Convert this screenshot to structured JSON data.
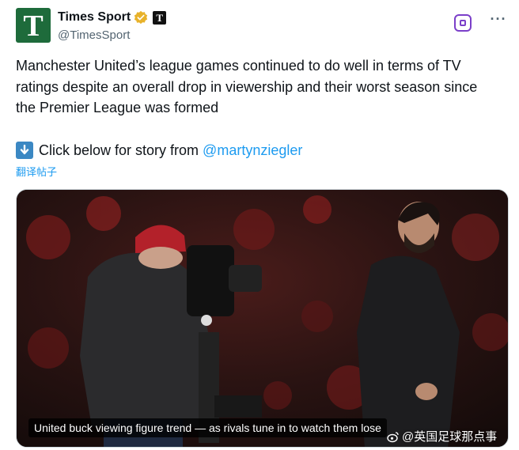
{
  "header": {
    "avatar_letter": "T",
    "display_name": "Times Sport",
    "affiliate_letter": "T",
    "handle": "@TimesSport"
  },
  "tweet": {
    "text": "Manchester United’s league games continued to do well in terms of TV ratings despite an overall drop in viewership and their worst season since the Premier League was formed",
    "link_prefix": "Click below for story from",
    "mention": "@martynziegler",
    "translate_label": "翻译帖子"
  },
  "media": {
    "caption": "United buck viewing figure trend — as rivals tune in to watch them lose",
    "watermark": "@英国足球那点事"
  },
  "colors": {
    "brand_green": "#1e6b3b",
    "link_blue": "#1d9bf0",
    "grok_purple": "#7b3fc9"
  },
  "icons": [
    "verified-icon",
    "grok-icon",
    "more-icon",
    "down-arrow-icon",
    "weibo-icon"
  ]
}
